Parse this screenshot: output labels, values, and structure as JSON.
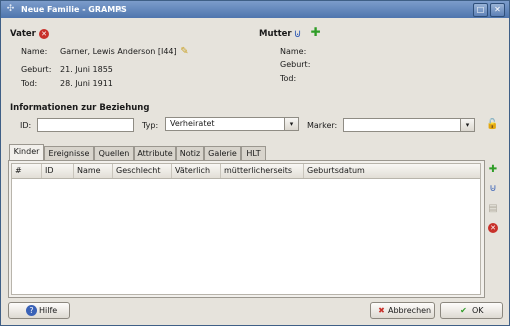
{
  "window": {
    "title": "Neue Familie - GRAMPS",
    "title_extra": "①"
  },
  "father": {
    "heading": "Vater",
    "name_label": "Name:",
    "name_value": "Garner, Lewis Anderson [I44]",
    "birth_label": "Geburt:",
    "birth_value": "21. Juni 1855",
    "death_label": "Tod:",
    "death_value": "28. Juni 1911"
  },
  "mother": {
    "heading": "Mutter",
    "name_label": "Name:",
    "birth_label": "Geburt:",
    "death_label": "Tod:"
  },
  "relationship": {
    "heading": "Informationen zur Beziehung",
    "id_label": "ID:",
    "id_value": "",
    "type_label": "Typ:",
    "type_value": "Verheiratet",
    "marker_label": "Marker:",
    "marker_value": ""
  },
  "tabs": [
    {
      "label": "Kinder"
    },
    {
      "label": "Ereignisse"
    },
    {
      "label": "Quellen"
    },
    {
      "label": "Attribute"
    },
    {
      "label": "Notiz"
    },
    {
      "label": "Galerie"
    },
    {
      "label": "HLT"
    }
  ],
  "children_table": {
    "columns": [
      "#",
      "ID",
      "Name",
      "Geschlecht",
      "Väterlich",
      "mütterlicherseits",
      "Geburtsdatum"
    ],
    "rows": []
  },
  "buttons": {
    "help": "Hilfe",
    "cancel": "Abbrechen",
    "ok": "OK"
  },
  "colors": {
    "titlebar": "#4e75ad",
    "add_icon": "#2f9d27",
    "remove_icon": "#c8312b",
    "link_icon": "#3a62b7"
  }
}
